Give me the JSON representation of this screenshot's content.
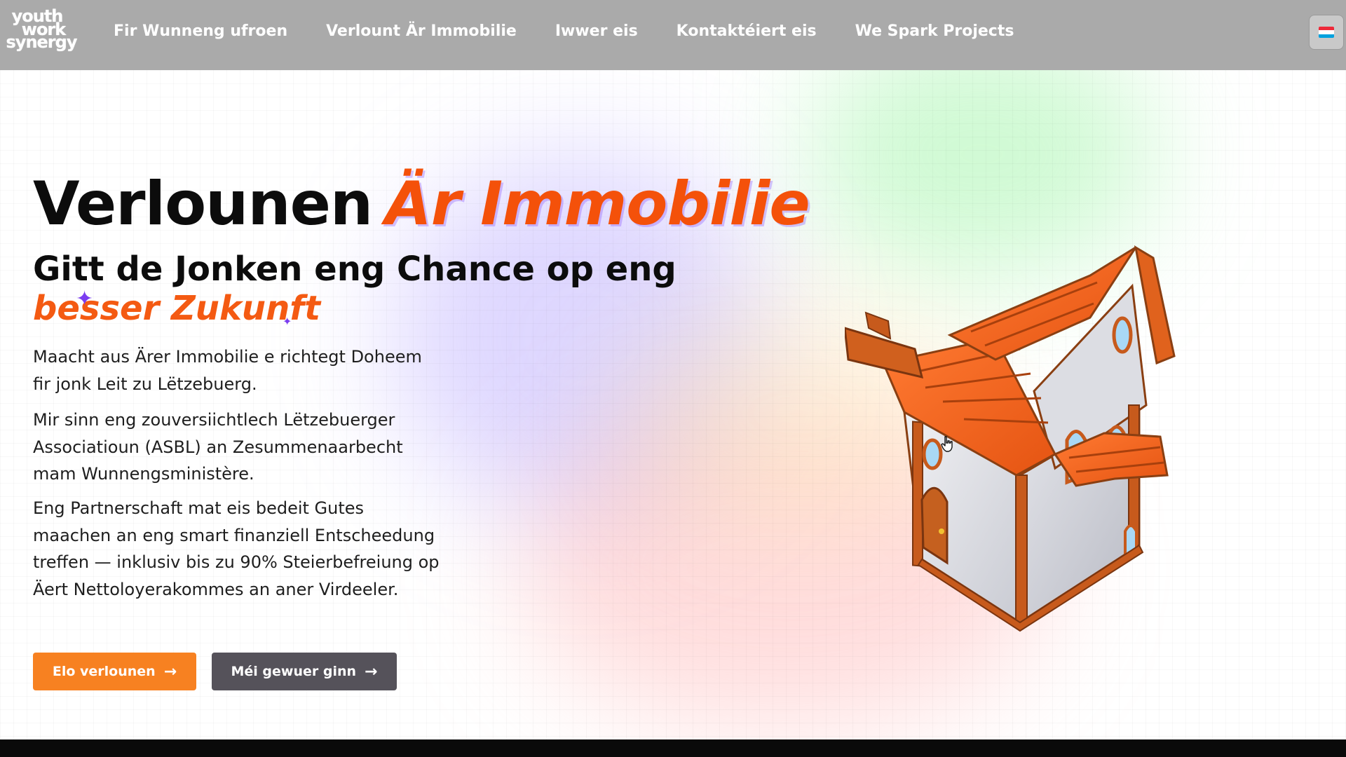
{
  "header": {
    "logo_lines": [
      "youth",
      "work",
      "synergy"
    ],
    "nav": [
      {
        "label": "Fir Wunneng ufroen"
      },
      {
        "label": "Verlount Är Immobilie"
      },
      {
        "label": "Iwwer eis"
      },
      {
        "label": "Kontaktéiert eis"
      },
      {
        "label": "We Spark Projects"
      }
    ],
    "language_icon": "luxembourg-flag-icon"
  },
  "hero": {
    "title_main": "Verlounen",
    "title_accent": "Är Immobilie",
    "subtitle_line1": "Gitt de Jonken eng Chance op eng",
    "subtitle_accent": "besser Zukunft",
    "paragraphs": [
      "Maacht aus Ärer Immobilie e richtegt Doheem fir jonk Leit zu Lëtzebuerg.",
      "Mir sinn eng zouversiichtlech Lëtzebuerger Associatioun (ASBL) an Zesummenaarbecht mam Wunnengsministère.",
      "Eng Partnerschaft mat eis bedeit Gutes maachen an eng smart finanziell Entscheedung treffen — inklusiv bis zu 90% Steierbefreiung op Äert Nettoloyerakommes an aner Virdeeler."
    ],
    "primary_button": "Elo verlounen",
    "secondary_button": "Méi gewuer ginn",
    "arrow": "→",
    "illustration": "cartoon-house-illustration"
  },
  "colors": {
    "accent_orange": "#f4510a",
    "button_orange": "#f78121",
    "button_gray": "#55525a",
    "header_gray": "#aaaaaa",
    "flag_red": "#ed2939",
    "flag_white": "#ffffff",
    "flag_blue": "#00a1de"
  }
}
